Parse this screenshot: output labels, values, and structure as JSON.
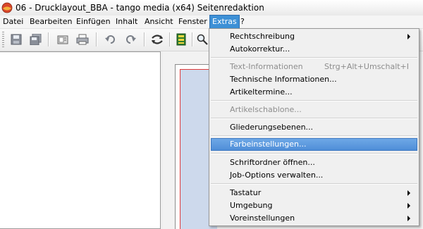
{
  "window": {
    "title": "06 - Drucklayout_BBA - tango media (x64) Seitenredaktion"
  },
  "menubar": {
    "items": [
      {
        "label": "Datei"
      },
      {
        "label": "Bearbeiten"
      },
      {
        "label": "Einfügen"
      },
      {
        "label": "Inhalt"
      },
      {
        "label": "Ansicht"
      },
      {
        "label": "Fenster"
      },
      {
        "label": "Extras"
      },
      {
        "label": "?"
      }
    ],
    "active": "Extras"
  },
  "toolbar": {
    "buttons": [
      {
        "icon": "save-icon"
      },
      {
        "icon": "save-all-icon"
      },
      {
        "icon": "open-icon"
      },
      {
        "icon": "print-icon"
      },
      {
        "icon": "undo-icon"
      },
      {
        "icon": "redo-icon"
      },
      {
        "icon": "refresh-icon"
      },
      {
        "icon": "layout-icon"
      },
      {
        "icon": "zoom-icon"
      }
    ]
  },
  "extras_menu": {
    "items": [
      {
        "label": "Rechtschreibung",
        "submenu": true
      },
      {
        "label": "Autokorrektur..."
      },
      {
        "label": "Text-Informationen",
        "shortcut": "Strg+Alt+Umschalt+I",
        "disabled": true
      },
      {
        "label": "Technische Informationen..."
      },
      {
        "label": "Artikeltermine..."
      },
      {
        "label": "Artikelschablone...",
        "disabled": true
      },
      {
        "label": "Gliederungsebenen..."
      },
      {
        "label": "Farbeinstellungen...",
        "highlighted": true
      },
      {
        "label": "Schriftordner öffnen..."
      },
      {
        "label": "Job-Options verwalten..."
      },
      {
        "label": "Tastatur",
        "submenu": true
      },
      {
        "label": "Umgebung",
        "submenu": true
      },
      {
        "label": "Voreinstellungen",
        "submenu": true
      }
    ]
  },
  "colors": {
    "menu_highlight": "#5b9ae0",
    "page_margin_guide": "#e03b3b",
    "page_content_area": "#cdd9ec"
  }
}
